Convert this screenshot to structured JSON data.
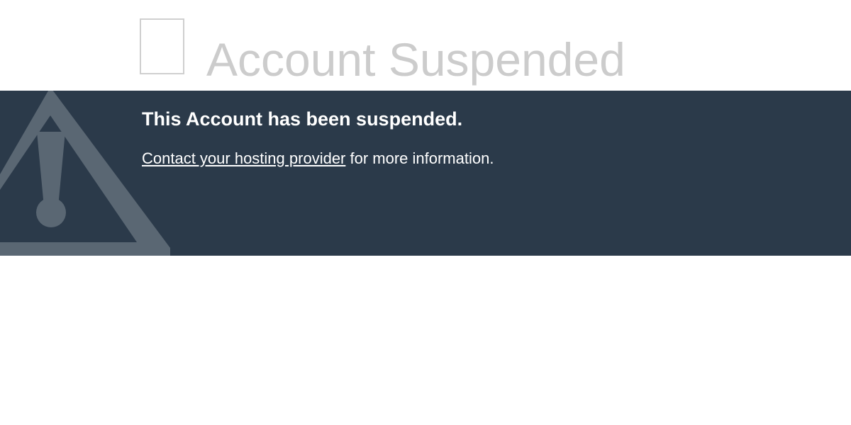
{
  "header": {
    "title": "Account Suspended",
    "icon": "broken-image-icon"
  },
  "banner": {
    "heading": "This Account has been suspended.",
    "link_text": "Contact your hosting provider",
    "message_suffix": " for more information.",
    "icon": "warning-triangle-icon",
    "background_color": "#2b3a4a",
    "icon_color": "#5a6773"
  }
}
